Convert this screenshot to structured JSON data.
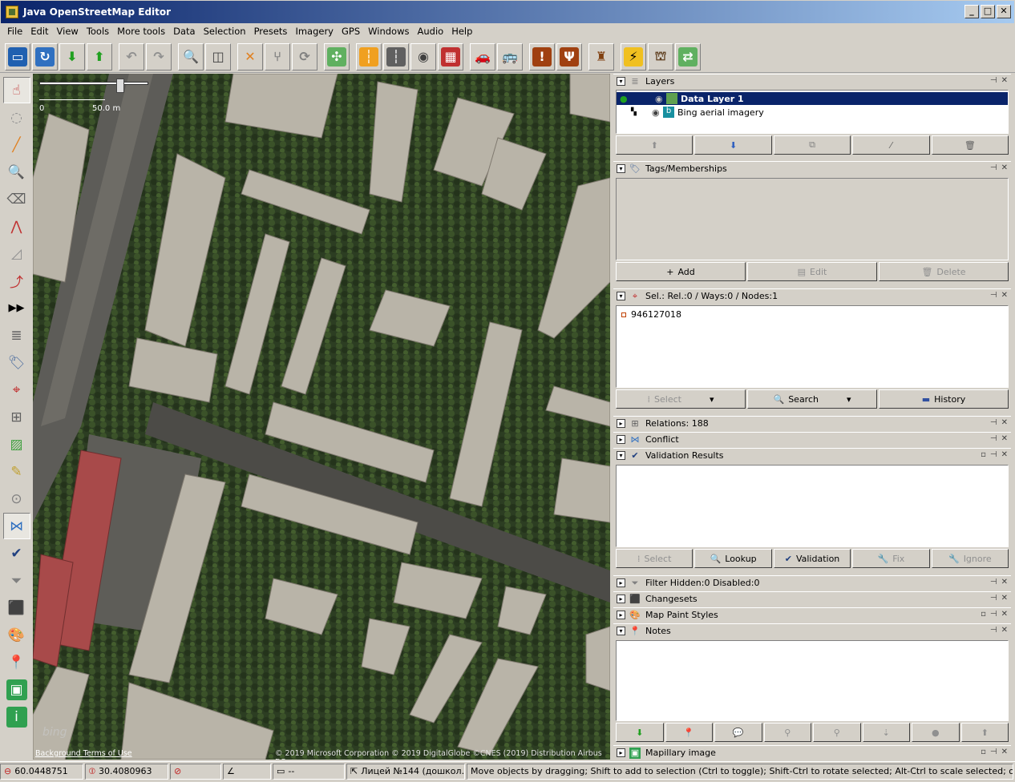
{
  "window": {
    "title": "Java OpenStreetMap Editor"
  },
  "menu": [
    "File",
    "Edit",
    "View",
    "Tools",
    "More tools",
    "Data",
    "Selection",
    "Presets",
    "Imagery",
    "GPS",
    "Windows",
    "Audio",
    "Help"
  ],
  "map": {
    "scale_start": "0",
    "scale_end": "50.0 m",
    "watermark": "bing",
    "footer_links": "Background Terms of Use",
    "attribution": "© 2019 Microsoft Corporation © 2019 DigitalGlobe ©CNES (2019) Distribution Airbus DS"
  },
  "layers": {
    "title": "Layers",
    "items": [
      {
        "name": "Data Layer 1",
        "selected": true
      },
      {
        "name": "Bing aerial imagery",
        "selected": false
      }
    ]
  },
  "tags": {
    "title": "Tags/Memberships",
    "add_label": "Add",
    "edit_label": "Edit",
    "delete_label": "Delete"
  },
  "selection": {
    "title": "Sel.: Rel.:0 / Ways:0 / Nodes:1",
    "items": [
      "946127018"
    ],
    "select_label": "Select",
    "search_label": "Search",
    "history_label": "History"
  },
  "relations": {
    "title": "Relations: 188"
  },
  "conflict": {
    "title": "Conflict"
  },
  "validation": {
    "title": "Validation Results",
    "select_label": "Select",
    "lookup_label": "Lookup",
    "validation_label": "Validation",
    "fix_label": "Fix",
    "ignore_label": "Ignore"
  },
  "filter": {
    "title": "Filter Hidden:0 Disabled:0"
  },
  "changesets": {
    "title": "Changesets"
  },
  "mappaint": {
    "title": "Map Paint Styles"
  },
  "notes": {
    "title": "Notes"
  },
  "mapillary": {
    "title": "Mapillary image"
  },
  "status": {
    "lat": "60.0448751",
    "lon": "30.4080963",
    "heading": "",
    "angle": "",
    "distance": "--",
    "name": "Лицей №144 (дошкол...",
    "help": "Move objects by dragging; Shift to add to selection (Ctrl to toggle); Shift-Ctrl to rotate selected; Alt-Ctrl to scale selected; or change selection"
  }
}
